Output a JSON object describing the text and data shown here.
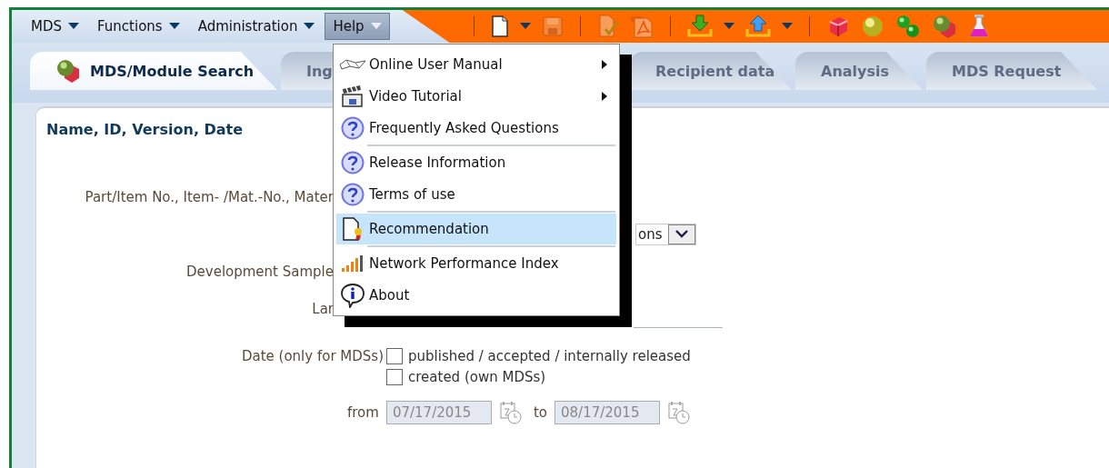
{
  "menubar": {
    "items": [
      {
        "label": "MDS",
        "selected": false
      },
      {
        "label": "Functions",
        "selected": false
      },
      {
        "label": "Administration",
        "selected": false
      },
      {
        "label": "Help",
        "selected": true
      }
    ]
  },
  "toolbar": {
    "items": [
      {
        "kind": "separator"
      },
      {
        "kind": "new-document",
        "disabled": false
      },
      {
        "kind": "caret",
        "disabled": false
      },
      {
        "kind": "save",
        "disabled": true
      },
      {
        "kind": "separator"
      },
      {
        "kind": "check-document",
        "disabled": true
      },
      {
        "kind": "pdf",
        "disabled": true
      },
      {
        "kind": "separator"
      },
      {
        "kind": "download",
        "disabled": false
      },
      {
        "kind": "caret",
        "disabled": false
      },
      {
        "kind": "upload",
        "disabled": false
      },
      {
        "kind": "caret",
        "disabled": false
      },
      {
        "kind": "separator"
      },
      {
        "kind": "cube",
        "disabled": false
      },
      {
        "kind": "sphere",
        "disabled": false
      },
      {
        "kind": "molecules",
        "disabled": false
      },
      {
        "kind": "component",
        "disabled": false
      },
      {
        "kind": "flask",
        "disabled": false
      }
    ]
  },
  "tabs": [
    {
      "label": "MDS/Module Search",
      "selected": true
    },
    {
      "label": "Ing",
      "selected": false
    },
    {
      "label": "Recipient data",
      "selected": false
    },
    {
      "label": "Analysis",
      "selected": false
    },
    {
      "label": "MDS Request",
      "selected": false
    }
  ],
  "form": {
    "section_title": "Name, ID, Version, Date",
    "rows": [
      {
        "kind": "label",
        "label": "Part/Item No., Item- /Mat.-No., Mater"
      },
      {
        "kind": "select",
        "value": "ons"
      },
      {
        "kind": "label",
        "label": "Development Sample"
      },
      {
        "kind": "label",
        "label": "Lar"
      }
    ],
    "date": {
      "label": "Date (only for MDSs)",
      "options": [
        {
          "label": "published / accepted / internally released",
          "checked": false
        },
        {
          "label": "created (own MDSs)",
          "checked": false
        }
      ],
      "from_label": "from",
      "from_value": "07/17/2015",
      "to_label": "to",
      "to_value": "08/17/2015"
    }
  },
  "help_menu": {
    "items": [
      {
        "label": "Online User Manual",
        "kind": "book",
        "submenu": true,
        "selected": false,
        "separator_after": false
      },
      {
        "label": "Video Tutorial",
        "kind": "clapboard",
        "submenu": true,
        "selected": false,
        "separator_after": false
      },
      {
        "label": "Frequently Asked Questions",
        "kind": "question",
        "submenu": false,
        "selected": false,
        "separator_after": true
      },
      {
        "label": "Release Information",
        "kind": "question",
        "submenu": false,
        "selected": false,
        "separator_after": false
      },
      {
        "label": "Terms of use",
        "kind": "question",
        "submenu": false,
        "selected": false,
        "separator_after": true
      },
      {
        "label": "Recommendation",
        "kind": "certificate",
        "submenu": false,
        "selected": true,
        "separator_after": true
      },
      {
        "label": "Network Performance Index",
        "kind": "signal",
        "submenu": false,
        "selected": false,
        "separator_after": false
      },
      {
        "label": "About",
        "kind": "info",
        "submenu": false,
        "selected": false,
        "separator_after": false
      }
    ]
  }
}
